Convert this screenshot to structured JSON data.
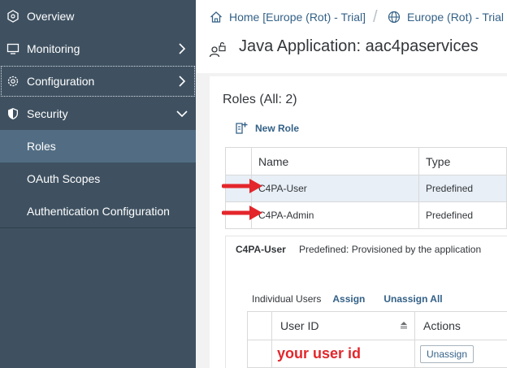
{
  "sidebar": {
    "items": [
      {
        "label": "Overview",
        "icon": "hexagon-icon"
      },
      {
        "label": "Monitoring",
        "icon": "monitor-icon"
      },
      {
        "label": "Configuration",
        "icon": "gear-icon"
      },
      {
        "label": "Security",
        "icon": "shield-icon"
      },
      {
        "label": "Roles"
      },
      {
        "label": "OAuth Scopes"
      },
      {
        "label": "Authentication Configuration"
      }
    ]
  },
  "breadcrumb": {
    "home": "Home [Europe (Rot) - Trial]",
    "region": "Europe (Rot) - Trial"
  },
  "header": {
    "title": "Java Application: aac4paservices"
  },
  "roles": {
    "title": "Roles (All: 2)",
    "new_role_label": "New Role",
    "columns": {
      "name": "Name",
      "type": "Type"
    },
    "rows": [
      {
        "name": "C4PA-User",
        "type": "Predefined"
      },
      {
        "name": "C4PA-Admin",
        "type": "Predefined"
      }
    ]
  },
  "detail": {
    "role_name": "C4PA-User",
    "description": "Predefined: Provisioned by the application",
    "toolbar": {
      "label": "Individual Users",
      "assign": "Assign",
      "unassign_all": "Unassign All"
    },
    "users_table": {
      "columns": {
        "user_id": "User ID",
        "actions": "Actions"
      },
      "rows": [
        {
          "user_id": "your user id",
          "action": "Unassign"
        }
      ]
    }
  },
  "colors": {
    "sidebar_bg": "#3f5161",
    "sidebar_selected": "#526d83",
    "link": "#346187",
    "annotation_red": "#e3262b"
  }
}
